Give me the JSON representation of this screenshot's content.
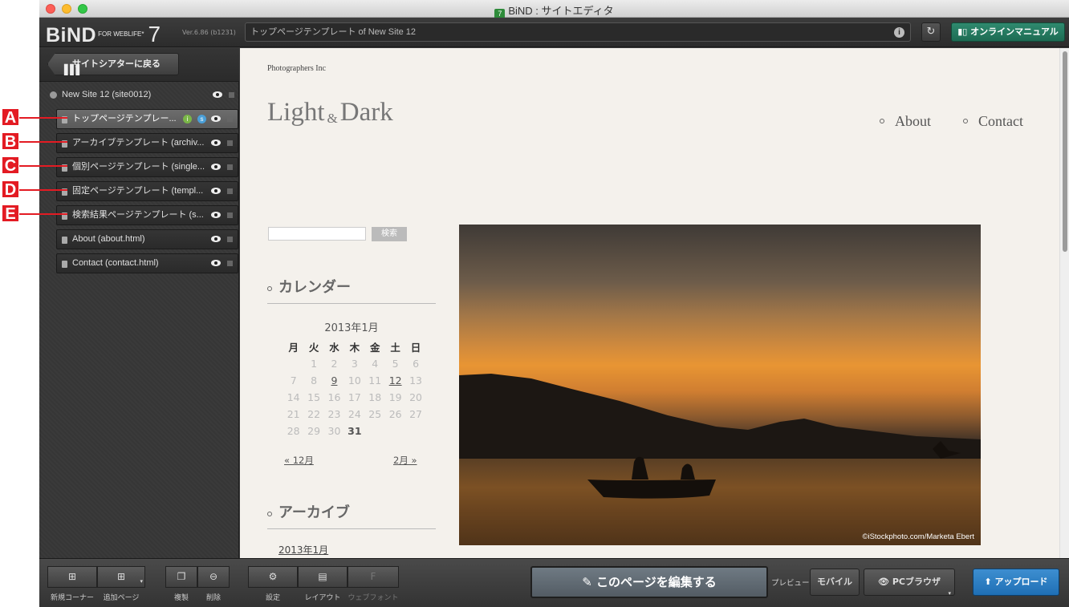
{
  "window": {
    "title": "BiND : サイトエディタ",
    "app_icon": "7"
  },
  "toolbar": {
    "logo_main": "BiND",
    "logo_sub": "FOR WEBLIFE*",
    "logo_num": "7",
    "version": "Ver.6.86 (b1231)",
    "url": "トップページテンプレート of New Site 12",
    "manual_label": "オンラインマニュアル"
  },
  "sidebar": {
    "back_label": "サイトシアターに戻る",
    "site_root": "New Site 12 (site0012)",
    "pages": [
      {
        "label": "トップページテンプレー..."
      },
      {
        "label": "アーカイブテンプレート (archiv..."
      },
      {
        "label": "個別ページテンプレート (single..."
      },
      {
        "label": "固定ページテンプレート (templ..."
      },
      {
        "label": "検索結果ページテンプレート (s..."
      },
      {
        "label": "About (about.html)"
      },
      {
        "label": "Contact (contact.html)"
      }
    ],
    "markers": [
      "A",
      "B",
      "C",
      "D",
      "E"
    ]
  },
  "page": {
    "company": "Photographers Inc",
    "title_a": "Light",
    "title_amp": "&",
    "title_b": "Dark",
    "nav": [
      "About",
      "Contact"
    ],
    "search_button": "検索",
    "calendar_heading": "カレンダー",
    "calendar_title": "2013年1月",
    "calendar_dow": [
      "月",
      "火",
      "水",
      "木",
      "金",
      "土",
      "日"
    ],
    "calendar_rows": [
      [
        "",
        "1",
        "2",
        "3",
        "4",
        "5",
        "6"
      ],
      [
        "7",
        "8",
        "9",
        "10",
        "11",
        "12",
        "13"
      ],
      [
        "14",
        "15",
        "16",
        "17",
        "18",
        "19",
        "20"
      ],
      [
        "21",
        "22",
        "23",
        "24",
        "25",
        "26",
        "27"
      ],
      [
        "28",
        "29",
        "30",
        "31",
        "",
        "",
        ""
      ]
    ],
    "prev_month": "« 12月",
    "next_month": "2月 »",
    "archive_heading": "アーカイブ",
    "archive_link": "2013年1月",
    "photo_credit": "©iStockphoto.com/Marketa Ebert"
  },
  "bottom": {
    "new_corner": "新規コーナー",
    "add_page": "追加ページ",
    "duplicate": "複製",
    "delete": "削除",
    "settings": "設定",
    "layout": "レイアウト",
    "webfont": "ウェブフォント",
    "webfont_icon": "F",
    "edit_page": "このページを編集する",
    "preview_label": "プレビュー",
    "mobile": "モバイル",
    "pc_browser": "PCブラウザ",
    "upload": "アップロード"
  },
  "colors": {
    "marker": "#e31b23",
    "manual": "#2f8a6f",
    "upload": "#2f80c6"
  }
}
